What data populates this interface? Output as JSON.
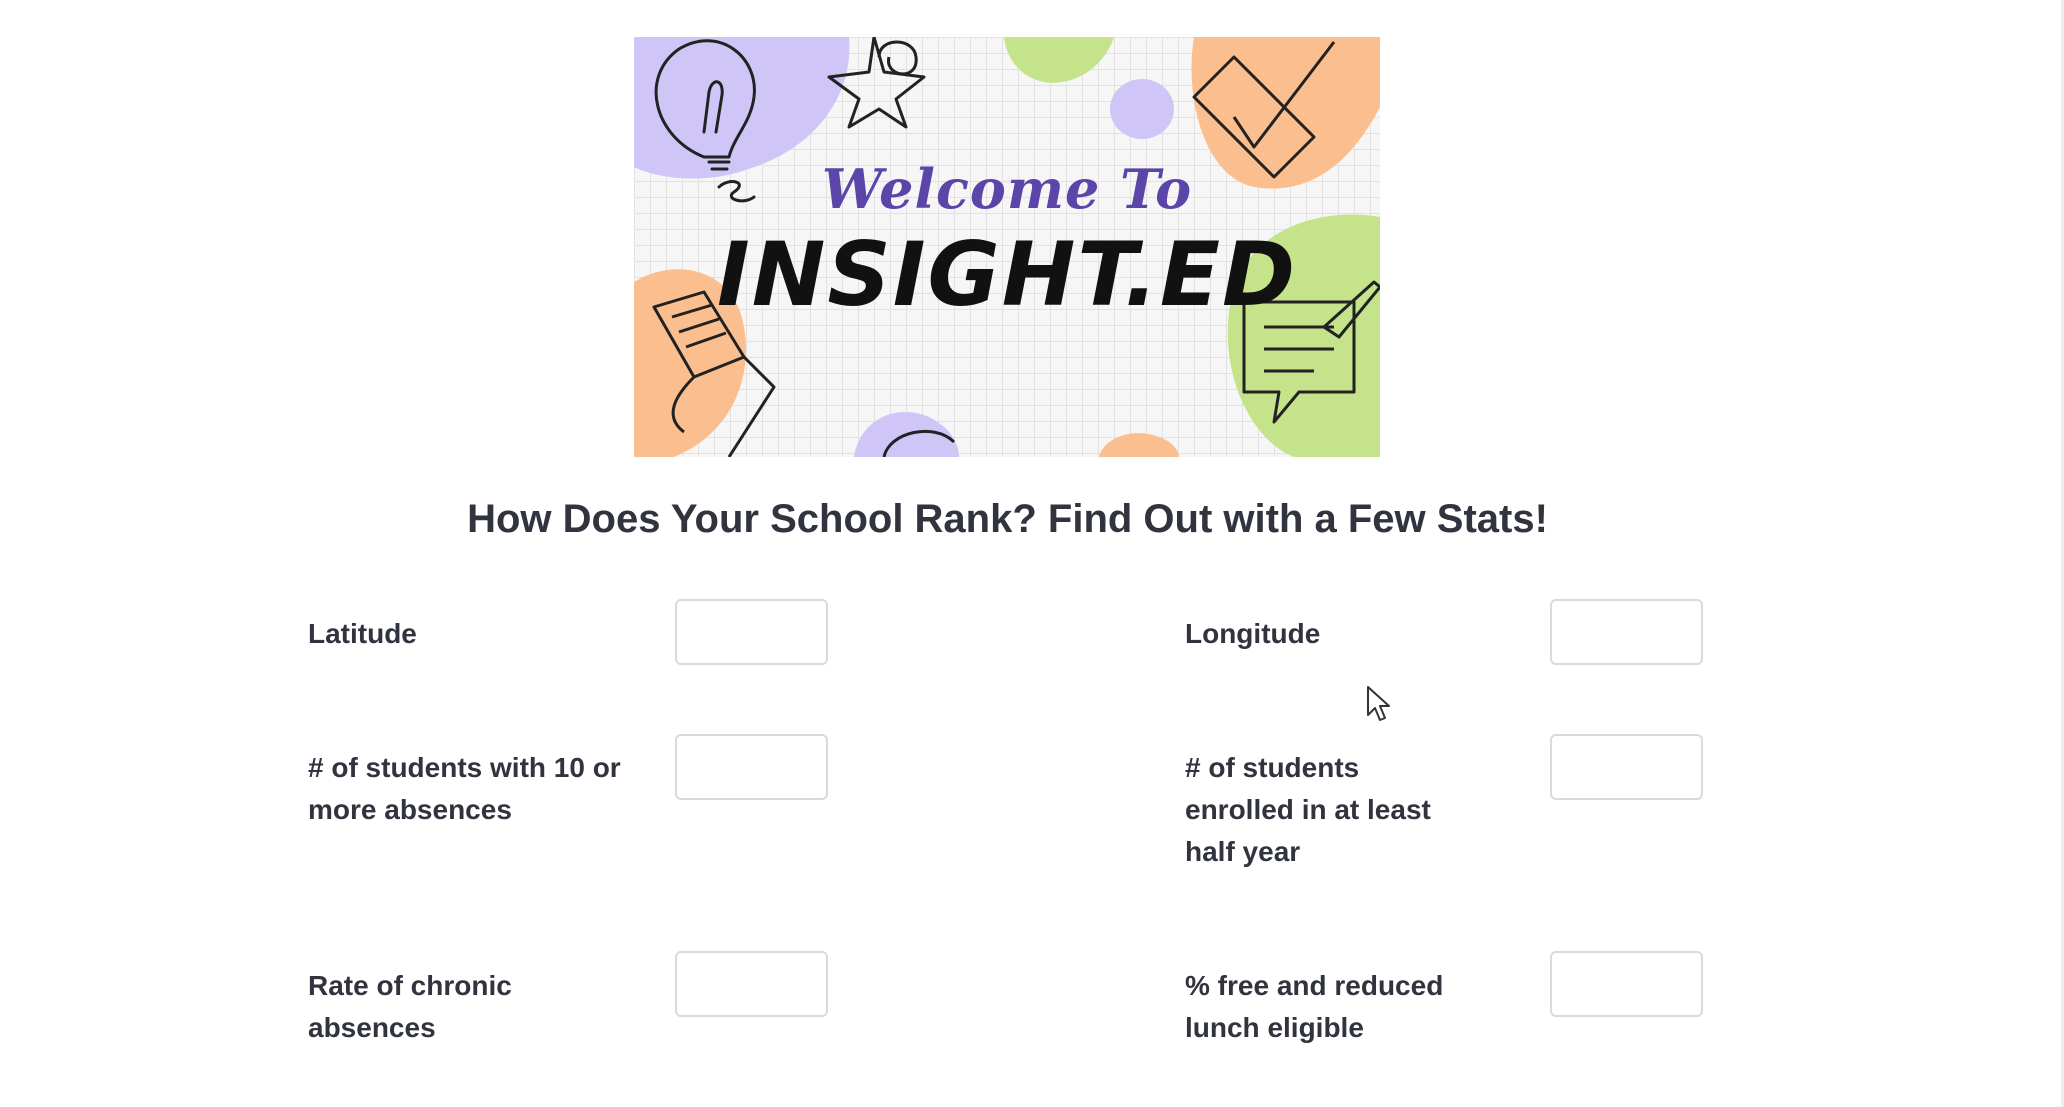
{
  "banner": {
    "welcome_text": "Welcome To",
    "brand_text": "INSIGHT.ED"
  },
  "heading": {
    "title": "How Does Your School Rank? Find Out with a Few Stats!"
  },
  "form": {
    "fields": [
      {
        "label": "Latitude",
        "value": ""
      },
      {
        "label": "Longitude",
        "value": ""
      },
      {
        "label": "# of students with 10 or more absences",
        "value": ""
      },
      {
        "label": "# of students enrolled in at least half year",
        "value": ""
      },
      {
        "label": "Rate of chronic absences",
        "value": ""
      },
      {
        "label": "% free and reduced lunch eligible",
        "value": ""
      }
    ]
  },
  "colors": {
    "lavender": "#cfc6f7",
    "peach": "#fbbf8f",
    "green": "#c5e38a",
    "brand_purple": "#5b45a8",
    "text": "#31333f"
  }
}
